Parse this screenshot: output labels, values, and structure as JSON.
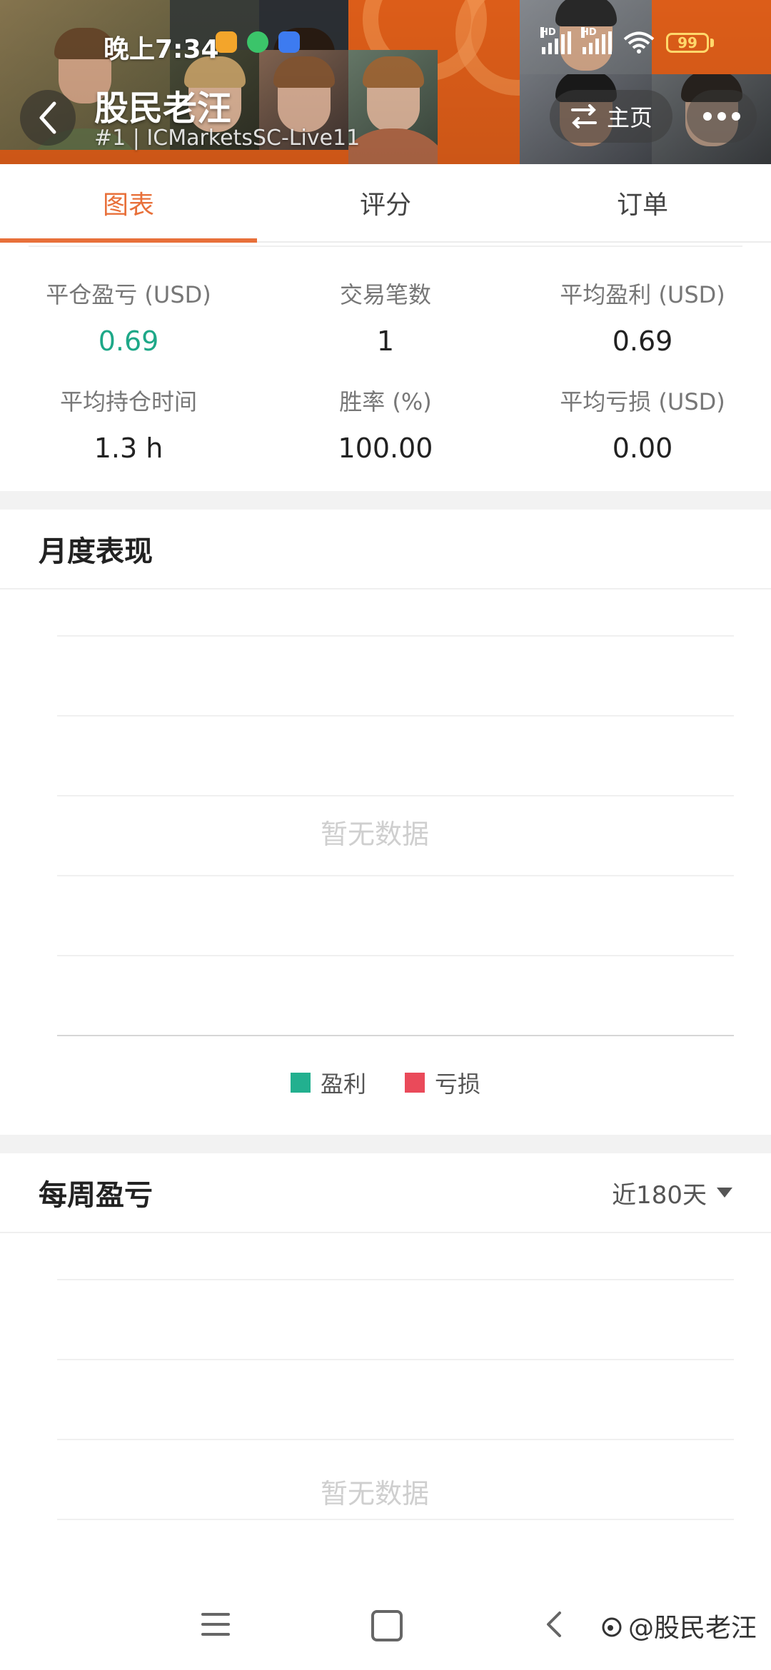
{
  "status_bar": {
    "time": "晚上7:34",
    "hd_1": "HD",
    "hd_2": "HD",
    "battery": "99"
  },
  "header": {
    "title": "股民老汪",
    "subtitle": "#1 | ICMarketsSC-Live11",
    "home_label": "主页"
  },
  "tabs": [
    {
      "label": "图表",
      "active": true
    },
    {
      "label": "评分",
      "active": false
    },
    {
      "label": "订单",
      "active": false
    }
  ],
  "stats": [
    {
      "label": "平仓盈亏 (USD)",
      "value": "0.69"
    },
    {
      "label": "交易笔数",
      "value": "1"
    },
    {
      "label": "平均盈利 (USD)",
      "value": "0.69"
    },
    {
      "label": "平均持仓时间",
      "value": "1.3 h"
    },
    {
      "label": "胜率 (%)",
      "value": "100.00"
    },
    {
      "label": "平均亏损 (USD)",
      "value": "0.00"
    }
  ],
  "monthly": {
    "title": "月度表现",
    "empty_text": "暂无数据",
    "legend": [
      {
        "label": "盈利",
        "color": "#22b08f"
      },
      {
        "label": "亏损",
        "color": "#ea4a5a"
      }
    ]
  },
  "weekly": {
    "title": "每周盈亏",
    "range": "近180天",
    "empty_text": "暂无数据"
  },
  "watermark": "@股民老汪",
  "colors": {
    "accent": "#e8703a",
    "profit": "#1ea888",
    "loss": "#ea4a5a"
  }
}
